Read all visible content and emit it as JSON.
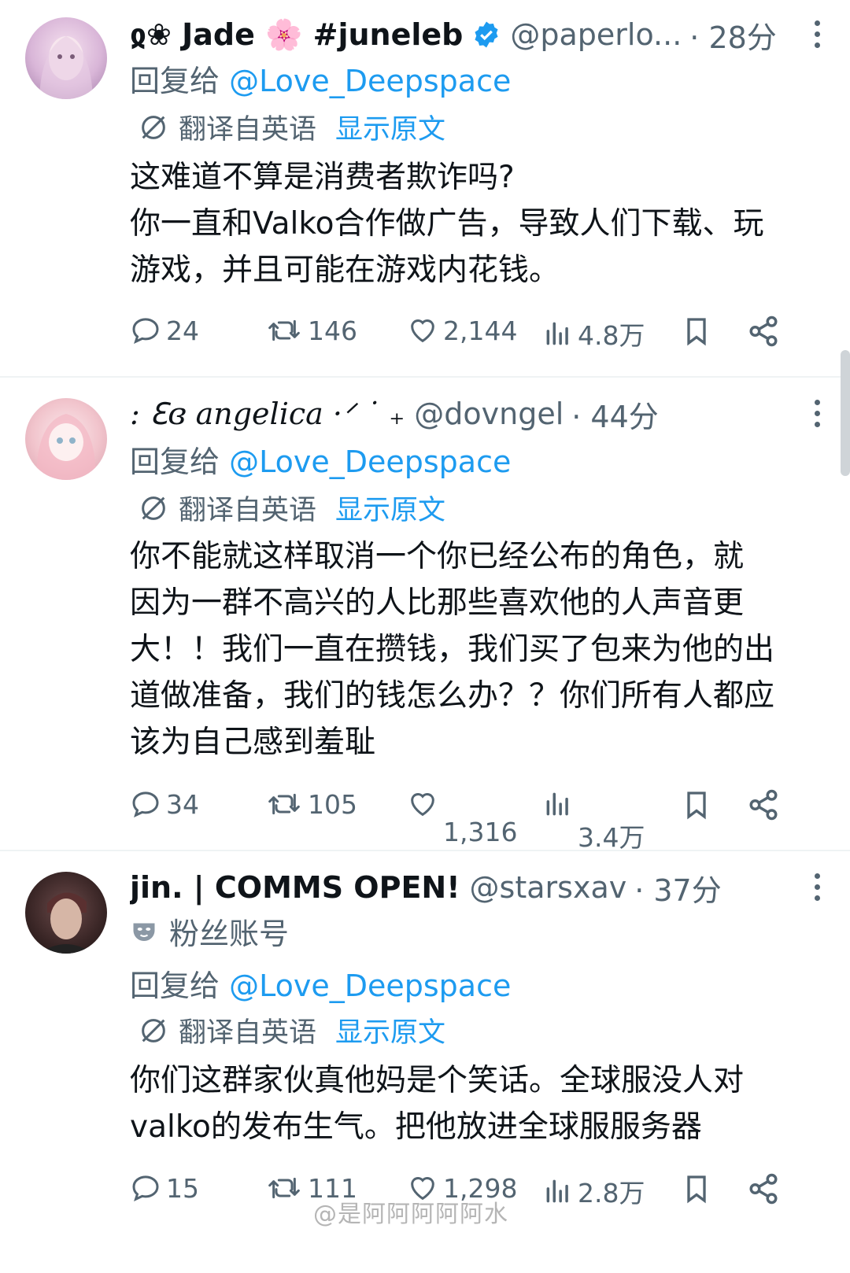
{
  "tweets": [
    {
      "name": "ჲ❀ Jade 🌸 #juneleb",
      "handle": "@paperlo...",
      "time": "· 28分",
      "fan_label": "",
      "reply_prefix": "回复给",
      "reply_to": "@Love_Deepspace",
      "translated_label": "翻译自英语",
      "show_original": "显示原文",
      "body": [
        "这难道不算是消费者欺诈吗?",
        "你一直和Valko合作做广告，导致人们下载、玩",
        "游戏，并且可能在游戏内花钱。"
      ],
      "replies": "24",
      "retweets": "146",
      "likes": "2,144",
      "views": "4.8万"
    },
    {
      "name": ": ℇɞ angelica ·ᐟ ˙ ₊",
      "handle": "@dovngel",
      "time": "· 44分",
      "fan_label": "",
      "reply_prefix": "回复给",
      "reply_to": "@Love_Deepspace",
      "translated_label": "翻译自英语",
      "show_original": "显示原文",
      "body": [
        "你不能就这样取消一个你已经公布的角色，就",
        "因为一群不高兴的人比那些喜欢他的人声音更",
        "大！！我们一直在攒钱，我们买了包来为他的出",
        "道做准备，我们的钱怎么办？？你们所有人都应",
        "该为自己感到羞耻"
      ],
      "replies": "34",
      "retweets": "105",
      "likes": "1,316",
      "views": "3.4万"
    },
    {
      "name": "jin. | COMMS OPEN!",
      "handle": "@starsxav",
      "time": "· 37分",
      "fan_label": "粉丝账号",
      "reply_prefix": "回复给",
      "reply_to": "@Love_Deepspace",
      "translated_label": "翻译自英语",
      "show_original": "显示原文",
      "body": [
        "你们这群家伙真他妈是个笑话。全球服没人对",
        "valko的发布生气。把他放进全球服服务器"
      ],
      "replies": "15",
      "retweets": "111",
      "likes": "1,298",
      "views": "2.8万"
    }
  ],
  "watermark": "@是阿阿阿阿阿水",
  "icons": {
    "reply": "speech-bubble-icon",
    "retweet": "retweet-icon",
    "like": "heart-icon",
    "views": "bar-chart-icon",
    "bookmark": "bookmark-icon",
    "share": "share-icon",
    "translate": "translate-icon",
    "verified": "verified-badge-icon",
    "fan": "mask-icon",
    "more": "more-dots-icon"
  },
  "colors": {
    "accent": "#1d9bf0",
    "secondary_text": "#536471",
    "primary_text": "#0f1419"
  }
}
